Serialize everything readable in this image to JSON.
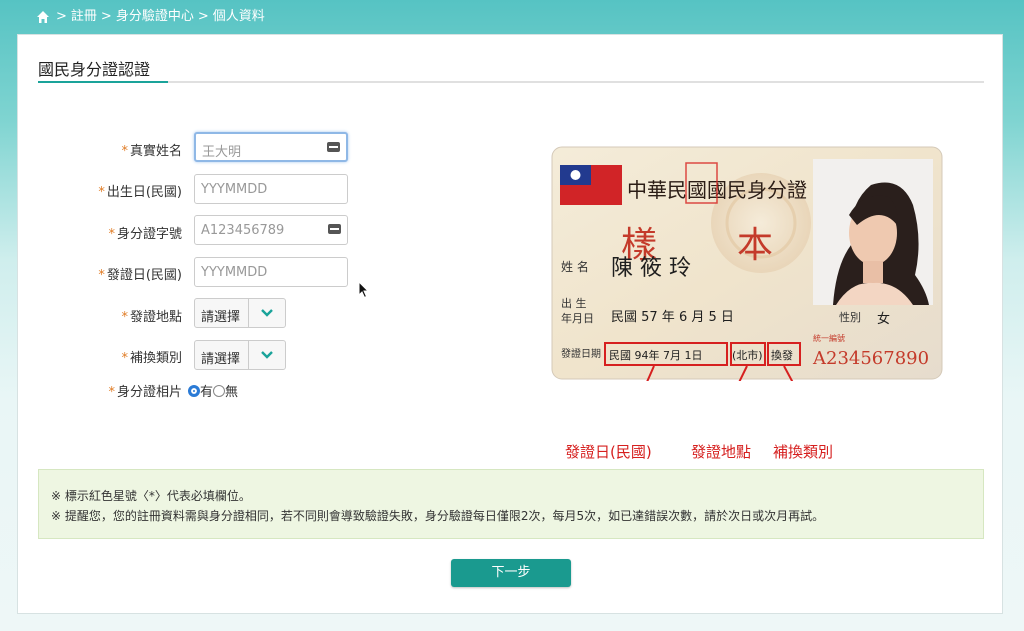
{
  "breadcrumb": {
    "items": [
      "註冊",
      "身分驗證中心",
      "個人資料"
    ],
    "separator": ">"
  },
  "section_title": "國民身分證認證",
  "form": {
    "name": {
      "label": "真實姓名",
      "placeholder": "王大明"
    },
    "birth": {
      "label": "出生日(民國)",
      "placeholder": "YYYMMDD"
    },
    "id_no": {
      "label": "身分證字號",
      "placeholder": "A123456789"
    },
    "issue_date": {
      "label": "發證日(民國)",
      "placeholder": "YYYMMDD"
    },
    "issue_place": {
      "label": "發證地點",
      "value": "請選擇"
    },
    "issue_type": {
      "label": "補換類別",
      "value": "請選擇"
    },
    "photo": {
      "label": "身分證相片",
      "options": [
        "有",
        "無"
      ],
      "selected": "有"
    },
    "required_mark": "*"
  },
  "id_card": {
    "title": "中華民國國民身分證",
    "sample_chars": [
      "樣",
      "本"
    ],
    "name_label": "姓 名",
    "name_value": "陳 筱 玲",
    "birth_label_1": "出 生",
    "birth_label_2": "年月日",
    "birth_value": "民國 57 年 6 月 5 日",
    "gender_label": "性別",
    "gender_value": "女",
    "issue_label": "發證日期",
    "issue_date_value": "民國 94年 7月 1日",
    "issue_place_value": "(北市)",
    "issue_type_value": "換發",
    "unified_label": "統一編號",
    "id_number": "A234567890",
    "callouts": [
      "發證日(民國)",
      "發證地點",
      "補換類別"
    ]
  },
  "notes": [
    "※ 標示紅色星號〈*〉代表必填欄位。",
    "※ 提醒您，您的註冊資料需與身分證相同，若不同則會導致驗證失敗，身分驗證每日僅限2次，每月5次，如已達錯誤次數，請於次日或次月再試。"
  ],
  "next_button": "下一步",
  "colors": {
    "accent": "#1aa39a",
    "required": "#e07b24",
    "callout_red": "#d6201f",
    "button": "#1a9a8f"
  }
}
